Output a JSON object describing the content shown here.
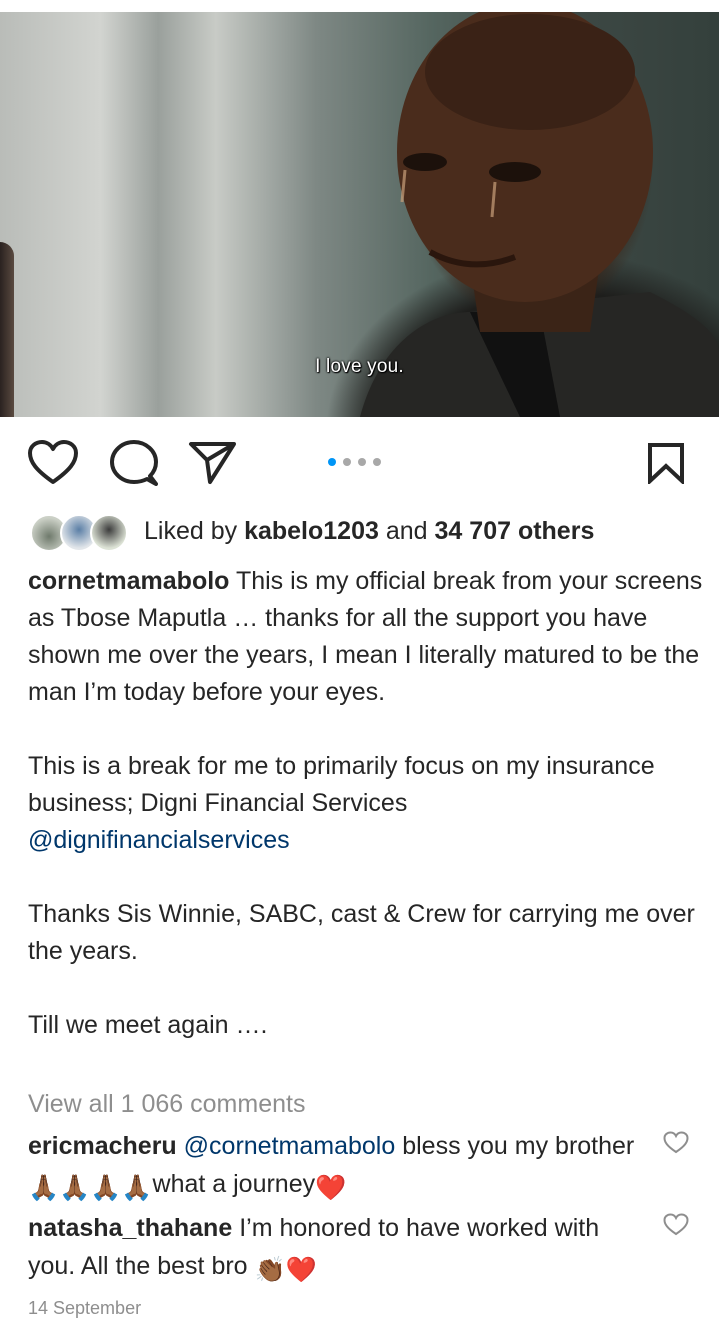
{
  "post": {
    "image": {
      "subtitle": "I love you.",
      "carousel_dots": 4,
      "active_dot": 0
    },
    "likes": {
      "prefix": "Liked by",
      "user": "kabelo1203",
      "middle": "and",
      "count": "34 707 others"
    },
    "caption": {
      "username": "cornetmamabolo",
      "para1": "This is my official break from your screens as Tbose Maputla … thanks for all the support you have shown me over the years, I mean I literally matured to be the man I’m today before your eyes.",
      "para2": "This is a break for me to primarily focus on my insurance business; Digni Financial Services",
      "mention": "@dignifinancialservices",
      "para3": "Thanks Sis Winnie, SABC, cast & Crew for carrying me over the years.",
      "para4": "Till we meet again …."
    },
    "view_all_comments": "View all 1 066 comments",
    "comments": [
      {
        "username": "ericmacheru",
        "mention": "@cornetmamabolo",
        "text_before": "bless you my brother",
        "emojis": "🙏🏾🙏🏾🙏🏾🙏🏾",
        "text_after": "what a journey",
        "end_emoji": "❤️"
      },
      {
        "username": "natasha_thahane",
        "text": "I’m honored to have worked with you. All the best bro",
        "end_emoji": "👏🏾❤️"
      }
    ],
    "date": "14 September"
  },
  "icons": {
    "like": "heart-outline-icon",
    "comment": "comment-bubble-icon",
    "share": "paper-plane-icon",
    "save": "bookmark-icon",
    "comment_like": "small-heart-icon"
  },
  "colors": {
    "text": "#262626",
    "muted": "#8e8e8e",
    "link": "#00376b",
    "active_dot": "#0095f6",
    "heart_red": "#e0245e"
  }
}
